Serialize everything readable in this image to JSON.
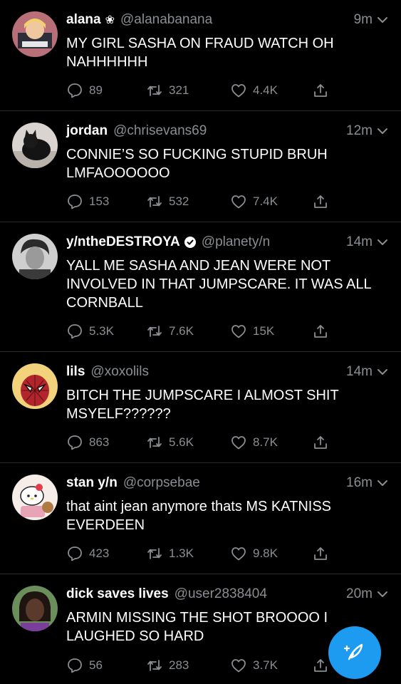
{
  "tweets": [
    {
      "name": "alana",
      "badge": "❀",
      "handle": "@alanabanana",
      "verified": false,
      "time": "9m",
      "text": "MY GIRL SASHA ON FRAUD WATCH OH NAHHHHHH",
      "replies": "89",
      "retweets": "321",
      "likes": "4.4K",
      "avatar_colors": [
        "#b86f78",
        "#f0c8a0"
      ]
    },
    {
      "name": "jordan",
      "badge": "",
      "handle": "@chrisevans69",
      "verified": false,
      "time": "12m",
      "text": "CONNIE’S SO FUCKING STUPID BRUH LMFAOOOOOO",
      "replies": "153",
      "retweets": "532",
      "likes": "7.4K",
      "avatar_colors": [
        "#d9d4cf",
        "#1a1a1a"
      ]
    },
    {
      "name": "y/ntheDESTROYA",
      "badge": "",
      "handle": "@planety/n",
      "verified": true,
      "time": "14m",
      "text": "YALL ME SASHA AND JEAN WERE NOT INVOLVED IN THAT JUMPSCARE. IT WAS ALL CORNBALL",
      "replies": "5.3K",
      "retweets": "7.6K",
      "likes": "15K",
      "avatar_colors": [
        "#c9c9c9",
        "#2b2b2b"
      ]
    },
    {
      "name": "lils",
      "badge": "",
      "handle": "@xoxolils",
      "verified": false,
      "time": "14m",
      "text": "BITCH THE JUMPSCARE I ALMOST SHIT MSYELF??????",
      "replies": "863",
      "retweets": "5.6K",
      "likes": "8.7K",
      "avatar_colors": [
        "#f2d27a",
        "#b3252c"
      ]
    },
    {
      "name": "stan y/n",
      "badge": "",
      "handle": "@corpsebae",
      "verified": false,
      "time": "16m",
      "text": "that aint jean anymore thats MS KATNISS EVERDEEN",
      "replies": "423",
      "retweets": "1.3K",
      "likes": "9.8K",
      "avatar_colors": [
        "#f6ede9",
        "#e8a4b6"
      ]
    },
    {
      "name": "dick saves lives",
      "badge": "",
      "handle": "@user2838404",
      "verified": false,
      "time": "20m",
      "text": "ARMIN MISSING THE SHOT BROOOO I LAUGHED SO HARD",
      "replies": "56",
      "retweets": "283",
      "likes": "3.7K",
      "avatar_colors": [
        "#6a8f5a",
        "#5a3a2a"
      ]
    }
  ],
  "icons": {
    "reply": "reply-icon",
    "retweet": "retweet-icon",
    "like": "heart-icon",
    "share": "share-icon",
    "menu": "chevron-down-icon",
    "compose": "compose-tweet-icon"
  },
  "colors": {
    "background": "#000000",
    "muted": "#8a8d91",
    "accent": "#1d9bf0",
    "divider": "#2a2a2a"
  }
}
